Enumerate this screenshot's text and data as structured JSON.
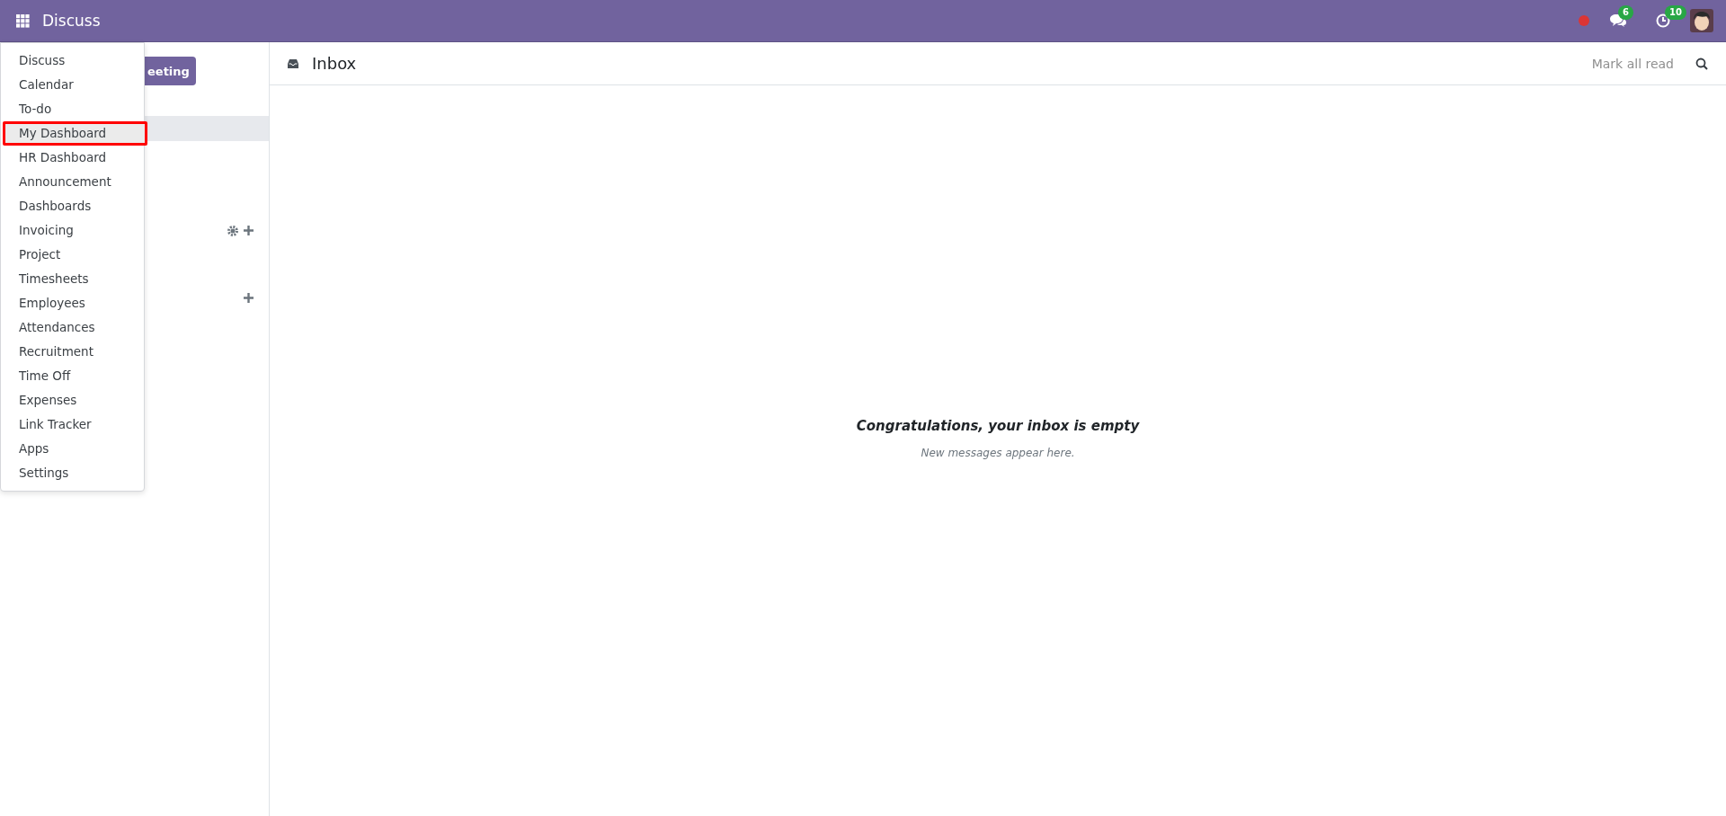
{
  "navbar": {
    "app_title": "Discuss",
    "messages_badge": "6",
    "activities_badge": "10"
  },
  "app_menu": {
    "items": [
      {
        "label": "Discuss",
        "highlighted": false
      },
      {
        "label": "Calendar",
        "highlighted": false
      },
      {
        "label": "To-do",
        "highlighted": false
      },
      {
        "label": "My Dashboard",
        "highlighted": true
      },
      {
        "label": "HR Dashboard",
        "highlighted": false
      },
      {
        "label": "Announcement",
        "highlighted": false
      },
      {
        "label": "Dashboards",
        "highlighted": false
      },
      {
        "label": "Invoicing",
        "highlighted": false
      },
      {
        "label": "Project",
        "highlighted": false
      },
      {
        "label": "Timesheets",
        "highlighted": false
      },
      {
        "label": "Employees",
        "highlighted": false
      },
      {
        "label": "Attendances",
        "highlighted": false
      },
      {
        "label": "Recruitment",
        "highlighted": false
      },
      {
        "label": "Time Off",
        "highlighted": false
      },
      {
        "label": "Expenses",
        "highlighted": false
      },
      {
        "label": "Link Tracker",
        "highlighted": false
      },
      {
        "label": "Apps",
        "highlighted": false
      },
      {
        "label": "Settings",
        "highlighted": false
      }
    ]
  },
  "sidebar": {
    "meeting_button": "eeting",
    "rows": [
      {
        "selected": true
      }
    ]
  },
  "header": {
    "title": "Inbox",
    "mark_all_read": "Mark all read"
  },
  "empty_state": {
    "title": "Congratulations, your inbox is empty",
    "subtitle": "New messages appear here."
  }
}
